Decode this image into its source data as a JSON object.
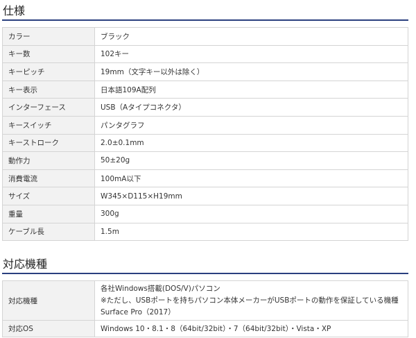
{
  "spec": {
    "title": "仕様",
    "rows": [
      {
        "label": "カラー",
        "value": "ブラック"
      },
      {
        "label": "キー数",
        "value": "102キー"
      },
      {
        "label": "キーピッチ",
        "value": "19mm（文字キー以外は除く）"
      },
      {
        "label": "キー表示",
        "value": "日本語109A配列"
      },
      {
        "label": "インターフェース",
        "value": "USB（Aタイプコネクタ）"
      },
      {
        "label": "キースイッチ",
        "value": "パンタグラフ"
      },
      {
        "label": "キーストローク",
        "value": "2.0±0.1mm"
      },
      {
        "label": "動作力",
        "value": "50±20g"
      },
      {
        "label": "消費電流",
        "value": "100mA以下"
      },
      {
        "label": "サイズ",
        "value": "W345×D115×H19mm"
      },
      {
        "label": "重量",
        "value": "300g"
      },
      {
        "label": "ケーブル長",
        "value": "1.5m"
      }
    ]
  },
  "compat": {
    "title": "対応機種",
    "rows": [
      {
        "label": "対応機種",
        "lines": [
          "各社Windows搭載(DOS/V)パソコン",
          "※ただし、USBポートを持ちパソコン本体メーカーがUSBポートの動作を保証している機種",
          "Surface Pro（2017）"
        ]
      },
      {
        "label": "対応OS",
        "value": "Windows 10・8.1・8（64bit/32bit）・7（64bit/32bit）・Vista・XP"
      }
    ]
  },
  "colors": {
    "rule": "#2a3f7f",
    "label_bg": "#f2f2f2",
    "border": "#d4d4d4"
  }
}
